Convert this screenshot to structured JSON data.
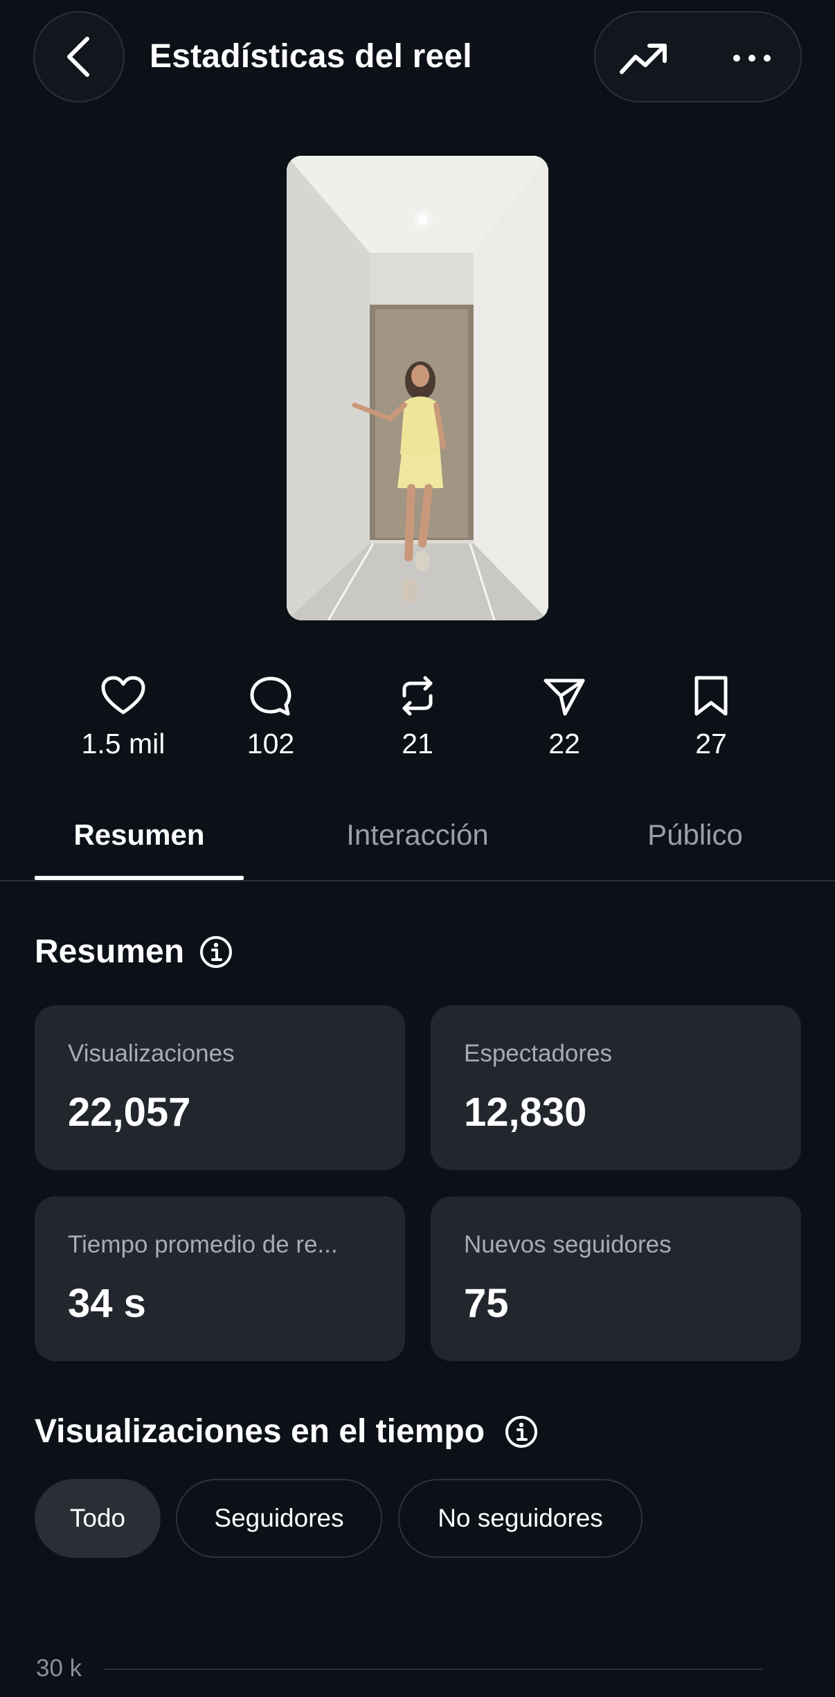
{
  "header": {
    "title": "Estadísticas del reel",
    "back_icon": "chevron-left-icon",
    "trend_icon": "trending-up-icon",
    "more_icon": "more-horizontal-icon"
  },
  "reel": {
    "thumbnail": "video-thumbnail"
  },
  "stats": [
    {
      "icon": "heart-icon",
      "value": "1.5 mil"
    },
    {
      "icon": "comment-icon",
      "value": "102"
    },
    {
      "icon": "repost-icon",
      "value": "21"
    },
    {
      "icon": "send-icon",
      "value": "22"
    },
    {
      "icon": "bookmark-icon",
      "value": "27"
    }
  ],
  "tabs": [
    {
      "label": "Resumen",
      "active": true
    },
    {
      "label": "Interacción",
      "active": false
    },
    {
      "label": "Público",
      "active": false
    }
  ],
  "summary": {
    "title": "Resumen",
    "cards": [
      {
        "label": "Visualizaciones",
        "value": "22,057"
      },
      {
        "label": "Espectadores",
        "value": "12,830"
      },
      {
        "label": "Tiempo promedio de re...",
        "value": "34 s"
      },
      {
        "label": "Nuevos seguidores",
        "value": "75"
      }
    ]
  },
  "views_over_time": {
    "title": "Visualizaciones en el tiempo",
    "filters": [
      {
        "label": "Todo",
        "active": true
      },
      {
        "label": "Seguidores",
        "active": false
      },
      {
        "label": "No seguidores",
        "active": false
      }
    ],
    "y_tick": "30 k"
  },
  "colors": {
    "background": "#0c1017",
    "card": "#22262d",
    "muted_text": "#a7adb5"
  }
}
